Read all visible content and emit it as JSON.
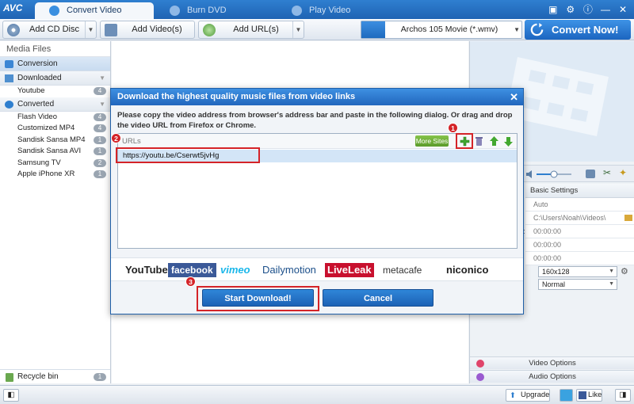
{
  "app": {
    "logo": "AVC",
    "tabs": [
      {
        "label": "Convert Video",
        "active": true
      },
      {
        "label": "Burn DVD",
        "active": false
      },
      {
        "label": "Play Video",
        "active": false
      }
    ],
    "window_icons": [
      "skin-icon",
      "settings-gear-icon",
      "info-icon",
      "minimize-icon",
      "close-icon"
    ]
  },
  "toolbar": {
    "add_cd": "Add CD Disc",
    "add_videos": "Add Video(s)",
    "add_urls": "Add URL(s)",
    "profile": "Archos 105 Movie (*.wmv)",
    "convert": "Convert Now!"
  },
  "left_panel": {
    "title": "Media Files",
    "conversion": "Conversion",
    "downloaded": {
      "label": "Downloaded",
      "items": [
        {
          "name": "Youtube",
          "count": "4"
        }
      ]
    },
    "converted": {
      "label": "Converted",
      "items": [
        {
          "name": "Flash Video",
          "count": "4"
        },
        {
          "name": "Customized MP4",
          "count": "4"
        },
        {
          "name": "Sandisk Sansa MP4",
          "count": "1"
        },
        {
          "name": "Sandisk Sansa AVI",
          "count": "1"
        },
        {
          "name": "Samsung TV",
          "count": "2"
        },
        {
          "name": "Apple iPhone XR",
          "count": "1"
        }
      ]
    },
    "recycle": {
      "label": "Recycle bin",
      "count": "1"
    }
  },
  "right_panel": {
    "settings_title": "Basic Settings",
    "rows": [
      {
        "label": "",
        "value": "Auto"
      },
      {
        "label": "",
        "value": "C:\\Users\\Noah\\Videos\\"
      },
      {
        "label": "e:",
        "value": "00:00:00"
      },
      {
        "label": "",
        "value": "00:00:00"
      },
      {
        "label": "",
        "value": "00:00:00"
      }
    ],
    "size_select": "160x128",
    "quality_select": "Normal",
    "video_options": "Video Options",
    "audio_options": "Audio Options"
  },
  "status": {
    "upgrade": "Upgrade",
    "like": "Like"
  },
  "dialog": {
    "title": "Download the highest quality music files from video links",
    "description": "Please copy the video address from browser's address bar and paste in the following dialog. Or drag and drop the video URL from Firefox or Chrome.",
    "urls_header": "URLs",
    "more_sites": "More Sites",
    "url_value": "https://youtu.be/Cserwt5jvHg",
    "logos": [
      "YouTube",
      "facebook",
      "vimeo",
      "Dailymotion",
      "LiveLeak",
      "metacafe",
      "niconico"
    ],
    "start_download": "Start Download!",
    "cancel": "Cancel",
    "markers": [
      "1",
      "2",
      "3"
    ],
    "colors": {
      "marker": "#d42328",
      "accent": "#1c62b6"
    }
  }
}
